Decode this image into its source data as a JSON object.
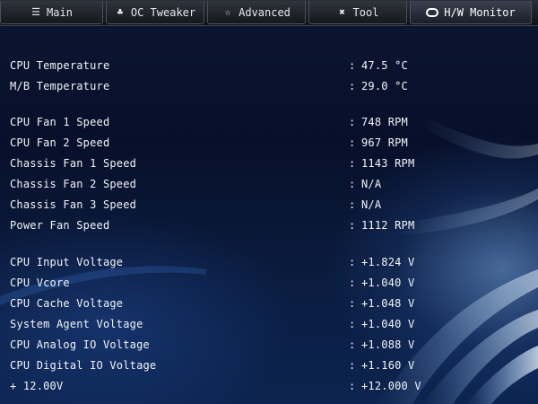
{
  "tabs": [
    {
      "label": "Main",
      "icon": "list-icon"
    },
    {
      "label": "OC Tweaker",
      "icon": "clover-icon"
    },
    {
      "label": "Advanced",
      "icon": "star-icon"
    },
    {
      "label": "Tool",
      "icon": "wrench-icon"
    },
    {
      "label": "H/W Monitor",
      "icon": "monitor-icon",
      "active": true
    }
  ],
  "separator": ":",
  "temperatures": [
    {
      "label": "CPU Temperature",
      "value": "47.5 °C"
    },
    {
      "label": "M/B Temperature",
      "value": "29.0 °C"
    }
  ],
  "fans": [
    {
      "label": "CPU Fan 1 Speed",
      "value": "748 RPM"
    },
    {
      "label": "CPU Fan 2 Speed",
      "value": "967 RPM"
    },
    {
      "label": "Chassis Fan 1 Speed",
      "value": "1143 RPM"
    },
    {
      "label": "Chassis Fan 2 Speed",
      "value": "N/A"
    },
    {
      "label": "Chassis Fan 3 Speed",
      "value": "N/A"
    },
    {
      "label": "Power Fan Speed",
      "value": "1112 RPM"
    }
  ],
  "voltages": [
    {
      "label": "CPU Input Voltage",
      "value": "+1.824 V"
    },
    {
      "label": "CPU Vcore",
      "value": "+1.040 V"
    },
    {
      "label": "CPU Cache Voltage",
      "value": "+1.048 V"
    },
    {
      "label": "System Agent Voltage",
      "value": "+1.040 V"
    },
    {
      "label": "CPU Analog IO Voltage",
      "value": "+1.088 V"
    },
    {
      "label": "CPU Digital IO Voltage",
      "value": "+1.160 V"
    },
    {
      "label": "+ 12.00V",
      "value": "+12.000 V"
    }
  ],
  "colors": {
    "text": "#f2f4f8",
    "background": "#07102a",
    "accent_glow": "#78aae6"
  }
}
